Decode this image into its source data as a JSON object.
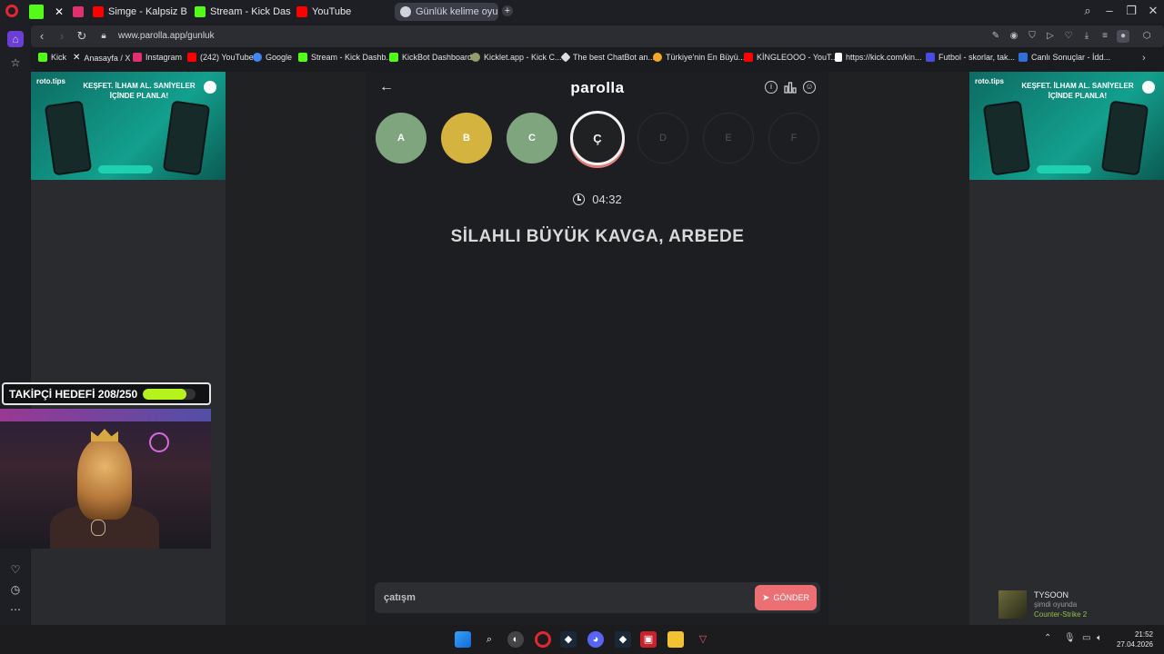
{
  "tabs": [
    {
      "title": "",
      "icon": "kick-icon",
      "color": "#53fc18"
    },
    {
      "title": "",
      "icon": "x-icon",
      "color": "#000000"
    },
    {
      "title": "",
      "icon": "instagram-icon",
      "color": "#e1306c"
    },
    {
      "title": "Simge - Kalpsiz Bir Serseri",
      "icon": "youtube-icon",
      "color": "#ff0000"
    },
    {
      "title": "Stream - Kick Dashboard",
      "icon": "kick-icon",
      "color": "#53fc18"
    },
    {
      "title": "YouTube",
      "icon": "youtube-icon",
      "color": "#ff0000"
    },
    {
      "title": "Günlük kelime oyunu - pa",
      "icon": "parolla-icon",
      "color": "#cfd3dc"
    }
  ],
  "address": {
    "url": "www.parolla.app/gunluk"
  },
  "bookmarks": [
    {
      "label": "Kick",
      "icon": "kick-icon",
      "color": "#53fc18"
    },
    {
      "label": "Anasayfa / X",
      "icon": "x-icon",
      "color": "#ffffff"
    },
    {
      "label": "Instagram",
      "icon": "instagram-icon",
      "color": "#e1306c"
    },
    {
      "label": "(242) YouTube",
      "icon": "youtube-icon",
      "color": "#ff0000"
    },
    {
      "label": "Google",
      "icon": "google-icon",
      "color": "#4285f4"
    },
    {
      "label": "Stream - Kick Dashb...",
      "icon": "kick-icon",
      "color": "#53fc18"
    },
    {
      "label": "KickBot Dashboard",
      "icon": "kickbot-icon",
      "color": "#53fc18"
    },
    {
      "label": "Kicklet.app - Kick C...",
      "icon": "kicklet-icon",
      "color": "#8f9e6b"
    },
    {
      "label": "The best ChatBot an...",
      "icon": "chatbot-icon",
      "color": "#dddddd"
    },
    {
      "label": "Türkiye'nin En Büyü...",
      "icon": "site-icon",
      "color": "#f5a623"
    },
    {
      "label": "KİNGLEOOO - YouT...",
      "icon": "youtube-icon",
      "color": "#ff0000"
    },
    {
      "label": "https://kick.com/kin...",
      "icon": "tiktok-icon",
      "color": "#ffffff"
    },
    {
      "label": "Futbol - skorlar, tak...",
      "icon": "flashscore-icon",
      "color": "#4b4bdf"
    },
    {
      "label": "Canlı Sonuçlar - İdd...",
      "icon": "results-icon",
      "color": "#2f6fd6"
    }
  ],
  "ad": {
    "brand": "roto.tips",
    "headline": "KEŞFET. İLHAM AL. SANİYELER İÇİNDE PLANLA!"
  },
  "game": {
    "title": "parolla",
    "letters": [
      {
        "letter": "A",
        "state": "correct"
      },
      {
        "letter": "B",
        "state": "partial"
      },
      {
        "letter": "C",
        "state": "correct"
      },
      {
        "letter": "Ç",
        "state": "current"
      },
      {
        "letter": "D",
        "state": "future"
      },
      {
        "letter": "E",
        "state": "future"
      },
      {
        "letter": "F",
        "state": "future"
      }
    ],
    "timer": "04:32",
    "clue": "SİLAHLI BÜYÜK KAVGA, ARBEDE",
    "answer_value": "çatışm",
    "submit_label": "GÖNDER",
    "colors": {
      "correct": "#7ea57d",
      "partial": "#d4b43e",
      "submit": "#ec6f74"
    }
  },
  "stream": {
    "goal_label": "TAKİPÇİ HEDEFİ 208/250",
    "goal_progress": 0.832
  },
  "notification": {
    "name": "TYSOON",
    "status": "şimdi oyunda",
    "game": "Counter-Strike 2"
  },
  "clock": {
    "time": "21:52",
    "date": "27.04.2026"
  }
}
